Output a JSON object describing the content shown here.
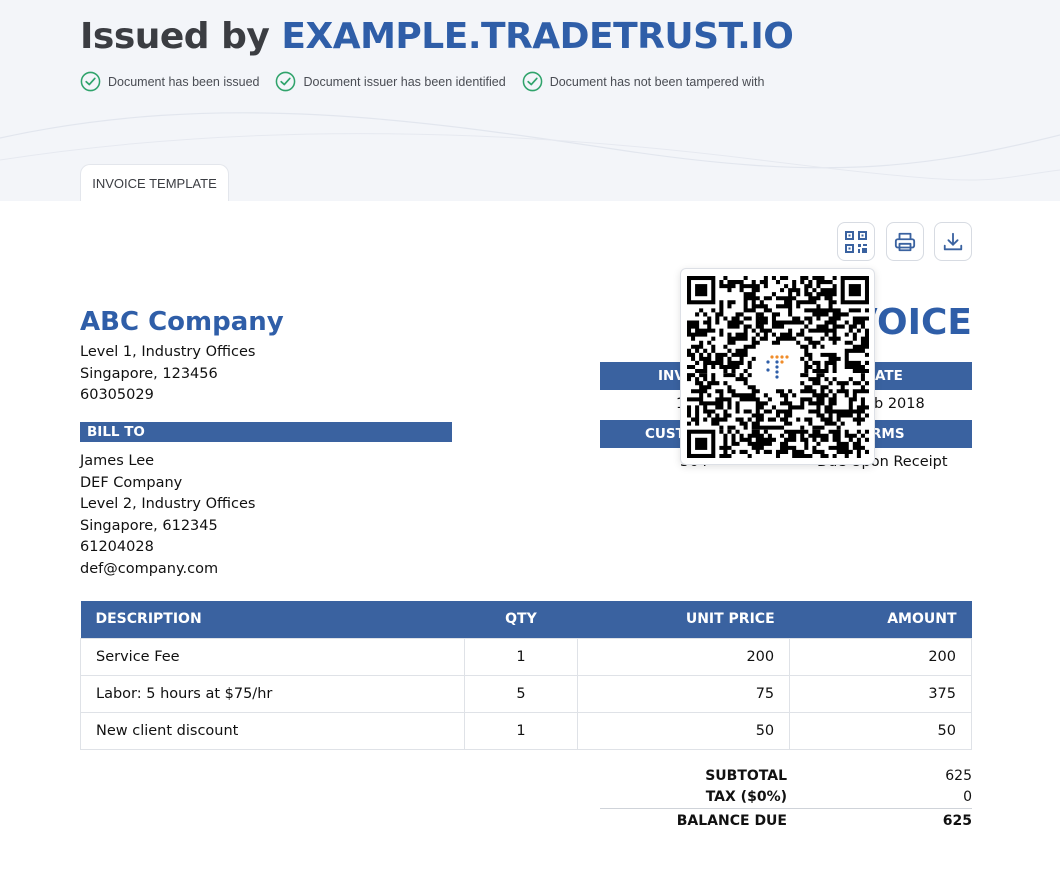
{
  "header": {
    "issued_prefix": "Issued by",
    "issuer_domain": "EXAMPLE.TRADETRUST.IO",
    "checks": [
      "Document has been issued",
      "Document issuer has been identified",
      "Document has not been tampered with"
    ],
    "tab_label": "INVOICE TEMPLATE"
  },
  "toolbar": {
    "qr_icon": "qr-code-icon",
    "print_icon": "printer-icon",
    "download_icon": "download-icon"
  },
  "company": {
    "name": "ABC Company",
    "lines": [
      "Level 1, Industry Offices",
      "Singapore, 123456",
      "60305029"
    ]
  },
  "invoice": {
    "title": "INVOICE",
    "title_visible": "VOICE",
    "invoice_no_label": "INV",
    "date_label": "ATE",
    "invoice_no_value": "1",
    "date_value": "b 2018",
    "customer_label": "CUST",
    "terms_label": "RMS",
    "customer_value": "564",
    "terms_value": "Due Upon Receipt"
  },
  "bill_to": {
    "heading": "BILL TO",
    "lines": [
      "James Lee",
      "DEF Company",
      "Level 2, Industry Offices",
      "Singapore, 612345",
      "61204028",
      "def@company.com"
    ]
  },
  "table": {
    "headers": [
      "DESCRIPTION",
      "QTY",
      "UNIT PRICE",
      "AMOUNT"
    ],
    "rows": [
      [
        "Service Fee",
        "1",
        "200",
        "200"
      ],
      [
        "Labor: 5 hours at $75/hr",
        "5",
        "75",
        "375"
      ],
      [
        "New client discount",
        "1",
        "50",
        "50"
      ]
    ]
  },
  "totals": {
    "subtotal_label": "SUBTOTAL",
    "subtotal_value": "625",
    "tax_label": "TAX ($0%)",
    "tax_value": "0",
    "due_label": "BALANCE DUE",
    "due_value": "625"
  },
  "colors": {
    "brand_blue": "#2f5ea8",
    "bar_blue": "#3a62a0",
    "check_green": "#2fa36b",
    "header_bg": "#f3f5f9"
  }
}
